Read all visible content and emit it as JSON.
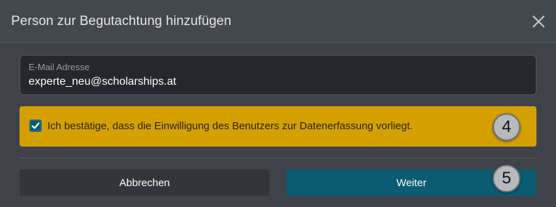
{
  "dialog": {
    "title": "Person zur Begutachtung hinzufügen",
    "close_icon": "close-icon"
  },
  "email": {
    "label": "E-Mail Adresse",
    "value": "experte_neu@scholarships.at"
  },
  "consent": {
    "checked": true,
    "checkbox_icon": "checkmark-icon",
    "text": "Ich bestätige, dass die Einwilligung des Benutzers zur Datenerfassung vorliegt."
  },
  "buttons": {
    "cancel_label": "Abbrechen",
    "next_label": "Weiter"
  },
  "annotations": {
    "badge_consent": "4",
    "badge_next": "5"
  },
  "colors": {
    "background": "#3f4349",
    "warning": "#d4a000",
    "primary": "#0b5b73",
    "secondary": "#32353a"
  }
}
